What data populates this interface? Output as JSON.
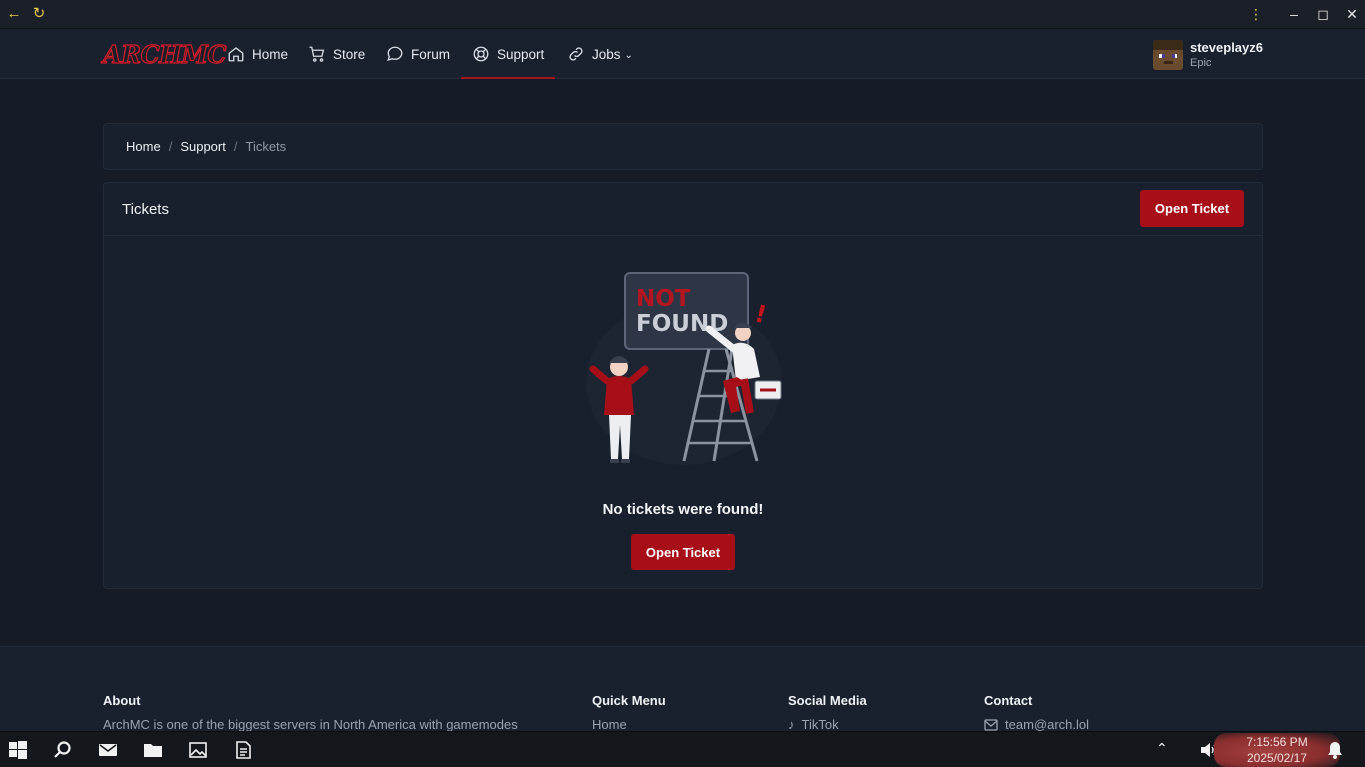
{
  "nav": {
    "logo": "ARCHMC",
    "items": [
      {
        "label": "Home",
        "icon": "home-icon"
      },
      {
        "label": "Store",
        "icon": "cart-icon"
      },
      {
        "label": "Forum",
        "icon": "chat-bubble-icon"
      },
      {
        "label": "Support",
        "icon": "lifebuoy-icon",
        "active": true
      },
      {
        "label": "Jobs",
        "icon": "link-icon",
        "dropdown": true
      }
    ],
    "user": {
      "name": "steveplayz6",
      "rank": "Epic"
    }
  },
  "breadcrumb": {
    "items": [
      "Home",
      "Support"
    ],
    "current": "Tickets"
  },
  "tickets": {
    "title": "Tickets",
    "open_button": "Open Ticket",
    "illustration_line1": "NOT",
    "illustration_line2": "FOUND",
    "empty_message": "No tickets were found!",
    "empty_button": "Open Ticket"
  },
  "footer": {
    "about": {
      "heading": "About",
      "text": "ArchMC is one of the biggest servers in North America with gamemodes"
    },
    "quick_menu": {
      "heading": "Quick Menu",
      "first": "Home"
    },
    "social": {
      "heading": "Social Media",
      "first": "TikTok"
    },
    "contact": {
      "heading": "Contact",
      "email": "team@arch.lol"
    }
  },
  "taskbar": {
    "time": "7:15:56 PM",
    "date": "2025/02/17"
  },
  "colors": {
    "accent": "#a70f18",
    "background": "#151c28",
    "card": "#18202d",
    "logo_stroke": "#d31b2a"
  }
}
